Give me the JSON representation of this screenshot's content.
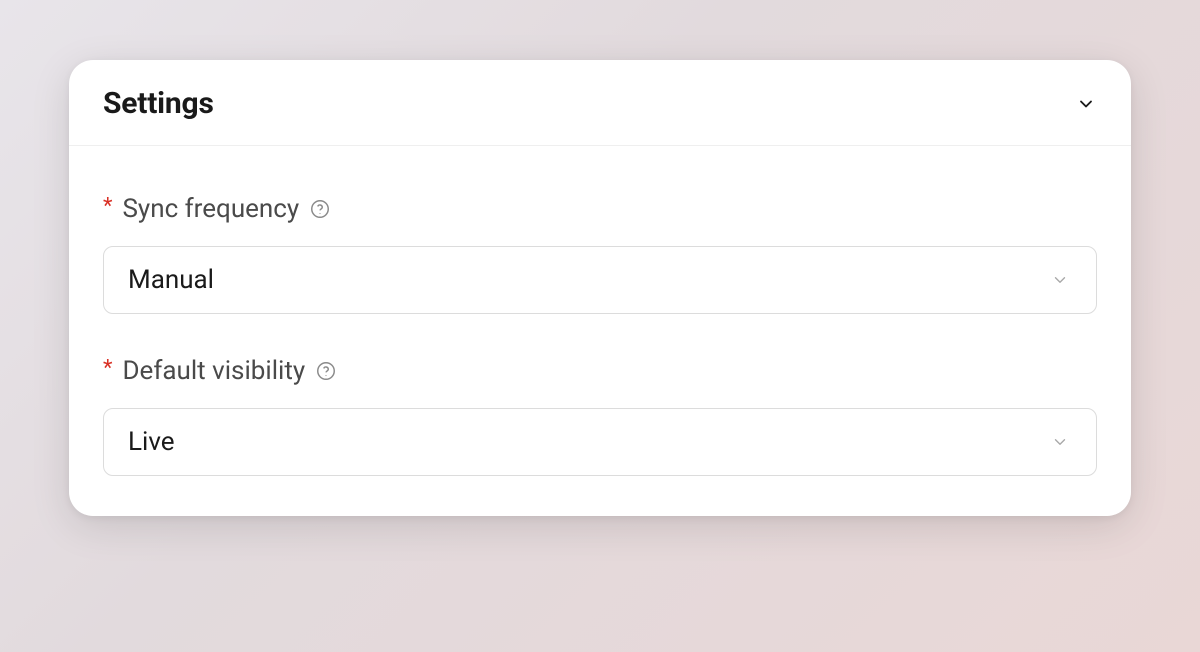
{
  "card": {
    "title": "Settings",
    "fields": {
      "sync_frequency": {
        "label": "Sync frequency",
        "required_marker": "*",
        "value": "Manual"
      },
      "default_visibility": {
        "label": "Default visibility",
        "required_marker": "*",
        "value": "Live"
      }
    }
  }
}
